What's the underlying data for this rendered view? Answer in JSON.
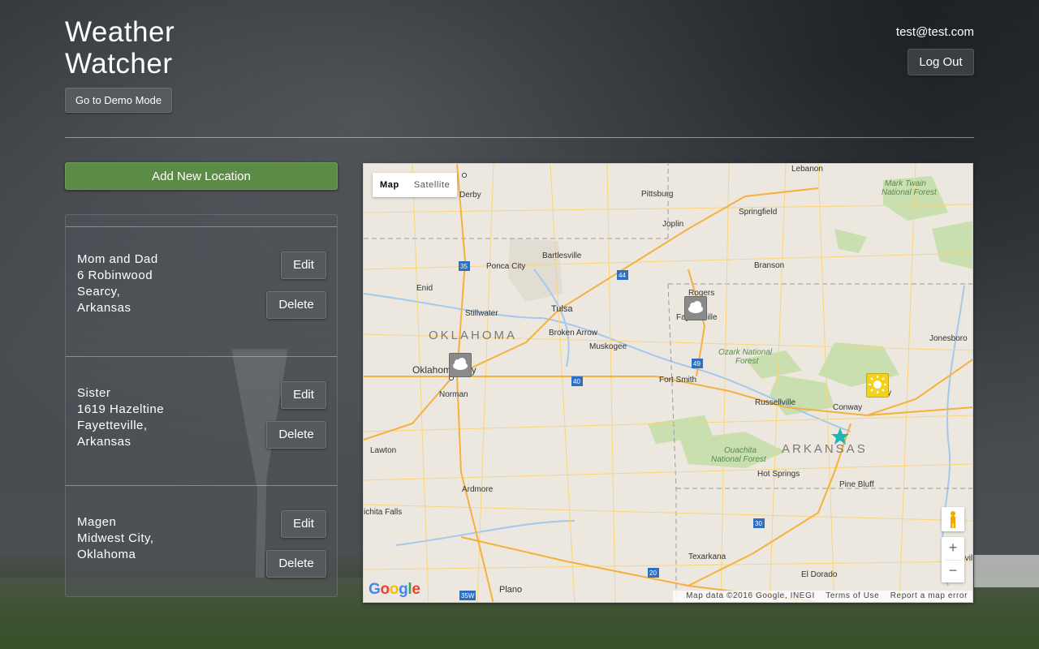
{
  "app": {
    "title_line1": "Weather",
    "title_line2": "Watcher",
    "demo_button": "Go to Demo Mode",
    "user_email": "test@test.com",
    "logout_button": "Log Out"
  },
  "sidebar": {
    "add_button": "Add New Location",
    "edit_label": "Edit",
    "delete_label": "Delete",
    "locations": [
      {
        "name": "Mom and Dad",
        "street": "6 Robinwood",
        "city": "Searcy,",
        "state": "Arkansas"
      },
      {
        "name": "Sister",
        "street": "1619 Hazeltine",
        "city": "Fayetteville,",
        "state": "Arkansas"
      },
      {
        "name": "Magen",
        "street": "Midwest City,",
        "state": "Oklahoma"
      }
    ]
  },
  "map": {
    "type_map": "Map",
    "type_satellite": "Satellite",
    "google_logo": "Google",
    "footer": {
      "data": "Map data ©2016 Google, INEGI",
      "terms": "Terms of Use",
      "report": "Report a map error"
    },
    "zoom_in": "+",
    "zoom_out": "−",
    "state_labels": {
      "oklahoma": "OKLAHOMA",
      "arkansas": "ARKANSAS"
    },
    "cities": {
      "lebanon": "Lebanon",
      "derby": "Derby",
      "pittsburg": "Pittsburg",
      "springfield": "Springfield",
      "mark_twain": "Mark Twain",
      "national_forest": "National Forest",
      "joplin": "Joplin",
      "ponca_city": "Ponca City",
      "bartlesville": "Bartlesville",
      "branson": "Branson",
      "enid": "Enid",
      "rogers": "Rogers",
      "fayetteville": "Fayetteville",
      "stillwater": "Stillwater",
      "tulsa": "Tulsa",
      "broken_arrow": "Broken Arrow",
      "jonesboro": "Jonesboro",
      "muskogee": "Muskogee",
      "ozark": "Ozark National",
      "forest": "Forest",
      "oklahoma_city": "Oklahoma City",
      "fort_smith": "Fort Smith",
      "norman": "Norman",
      "russellville": "Russellville",
      "conway": "Conway",
      "lawton": "Lawton",
      "ouachita": "Ouachita",
      "hot_springs": "Hot Springs",
      "ardmore": "Ardmore",
      "pine_bluff": "Pine Bluff",
      "wichita_falls": "ichita Falls",
      "texarkana": "Texarkana",
      "greenville": "Greenvill",
      "el_dorado": "El Dorado",
      "plano": "Plano",
      "label_cy": "cy"
    },
    "highways": [
      "35",
      "44",
      "40",
      "49",
      "30",
      "20",
      "35W"
    ],
    "markers": [
      {
        "location": "Mom and Dad",
        "condition": "sunny",
        "icon": "sun-icon"
      },
      {
        "location": "Sister",
        "condition": "cloudy",
        "icon": "cloud-icon"
      },
      {
        "location": "Magen",
        "condition": "cloudy",
        "icon": "cloud-icon"
      }
    ],
    "colors": {
      "land": "#ece8df",
      "forest": "#c9dfaf",
      "water": "#a5c8ee",
      "highway": "#f4b13f",
      "road": "#fbd47a"
    }
  }
}
